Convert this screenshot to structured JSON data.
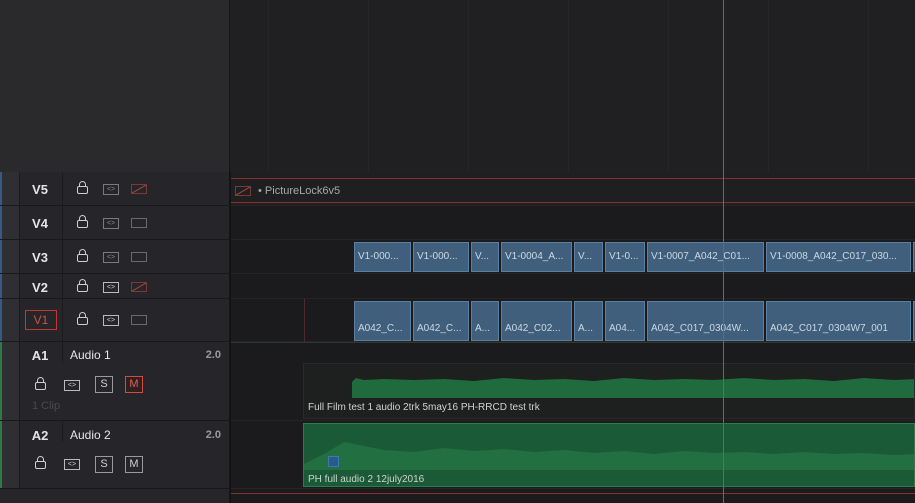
{
  "tracks": {
    "video": [
      {
        "id": "V5",
        "auto_select": false,
        "monitor_enabled": false
      },
      {
        "id": "V4",
        "auto_select": false,
        "monitor_enabled": true
      },
      {
        "id": "V3",
        "auto_select": false,
        "monitor_enabled": true
      },
      {
        "id": "V2",
        "auto_select": true,
        "monitor_enabled": false
      },
      {
        "id": "V1",
        "auto_select": true,
        "monitor_enabled": true,
        "destination": true
      }
    ],
    "audio": [
      {
        "id": "A1",
        "name": "Audio 1",
        "channels": "2.0",
        "solo_label": "S",
        "mute_label": "M",
        "muted": true,
        "clip_count": "1 Clip"
      },
      {
        "id": "A2",
        "name": "Audio 2",
        "channels": "2.0",
        "solo_label": "S",
        "mute_label": "M",
        "muted": false
      }
    ]
  },
  "timeline": {
    "v5_label": "• PictureLock6v5",
    "v3_clips": [
      "V1-000...",
      "V1-000...",
      "V...",
      "V1-0004_A...",
      "V...",
      "V1-0...",
      "V1-0007_A042_C01...",
      "V1-0008_A042_C017_030...",
      ""
    ],
    "v1_clips": [
      "A042_C...",
      "A042_C...",
      "A...",
      "A042_C02...",
      "A...",
      "A04...",
      "A042_C017_0304W...",
      "A042_C017_0304W7_001",
      ""
    ],
    "a1_clip": "Full Film test 1 audio 2trk 5may16 PH-RRCD test trk",
    "a2_clip": "PH full audio 2 12july2016"
  },
  "colors": {
    "playhead": "#c8423a",
    "video_clip": "#3f5f7c",
    "audio_clip": "#1a5a36",
    "mute_active": "#d24c3f"
  }
}
